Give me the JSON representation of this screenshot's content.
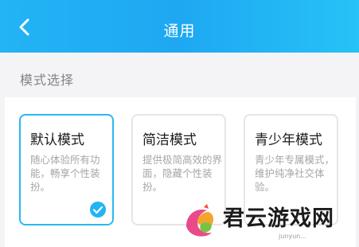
{
  "header": {
    "title": "通用",
    "back_icon": "chevron-left-icon"
  },
  "section": {
    "label": "模式选择"
  },
  "modes": [
    {
      "title": "默认模式",
      "desc": "随心体验所有功能，畅享个性装扮。",
      "selected": true
    },
    {
      "title": "简洁模式",
      "desc": "提供极简高效的界面，隐藏个性装扮。",
      "selected": false
    },
    {
      "title": "青少年模式",
      "desc": "青少年专属模式，维护纯净社交体验。",
      "selected": false
    }
  ],
  "watermark": {
    "text": "君云游戏网",
    "sub": "junyun..."
  },
  "colors": {
    "accent": "#22b4f4",
    "header_gradient_start": "#22b4f4",
    "header_gradient_end": "#27c2f7",
    "selected_border": "#2bb8f1",
    "card_border": "#e5e5ea",
    "description_text": "#a6a6ab"
  }
}
